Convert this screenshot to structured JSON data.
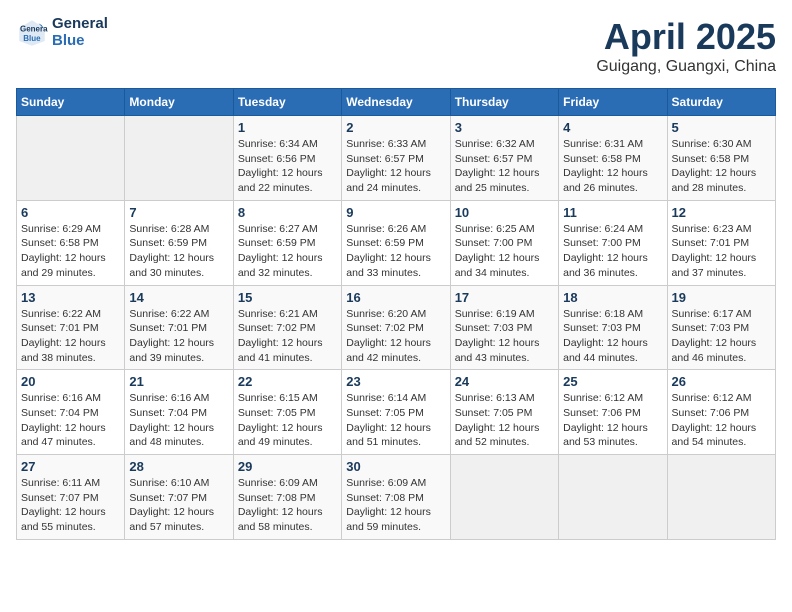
{
  "header": {
    "logo_line1": "General",
    "logo_line2": "Blue",
    "month_title": "April 2025",
    "location": "Guigang, Guangxi, China"
  },
  "weekdays": [
    "Sunday",
    "Monday",
    "Tuesday",
    "Wednesday",
    "Thursday",
    "Friday",
    "Saturday"
  ],
  "weeks": [
    [
      {
        "day": "",
        "info": ""
      },
      {
        "day": "",
        "info": ""
      },
      {
        "day": "1",
        "info": "Sunrise: 6:34 AM\nSunset: 6:56 PM\nDaylight: 12 hours\nand 22 minutes."
      },
      {
        "day": "2",
        "info": "Sunrise: 6:33 AM\nSunset: 6:57 PM\nDaylight: 12 hours\nand 24 minutes."
      },
      {
        "day": "3",
        "info": "Sunrise: 6:32 AM\nSunset: 6:57 PM\nDaylight: 12 hours\nand 25 minutes."
      },
      {
        "day": "4",
        "info": "Sunrise: 6:31 AM\nSunset: 6:58 PM\nDaylight: 12 hours\nand 26 minutes."
      },
      {
        "day": "5",
        "info": "Sunrise: 6:30 AM\nSunset: 6:58 PM\nDaylight: 12 hours\nand 28 minutes."
      }
    ],
    [
      {
        "day": "6",
        "info": "Sunrise: 6:29 AM\nSunset: 6:58 PM\nDaylight: 12 hours\nand 29 minutes."
      },
      {
        "day": "7",
        "info": "Sunrise: 6:28 AM\nSunset: 6:59 PM\nDaylight: 12 hours\nand 30 minutes."
      },
      {
        "day": "8",
        "info": "Sunrise: 6:27 AM\nSunset: 6:59 PM\nDaylight: 12 hours\nand 32 minutes."
      },
      {
        "day": "9",
        "info": "Sunrise: 6:26 AM\nSunset: 6:59 PM\nDaylight: 12 hours\nand 33 minutes."
      },
      {
        "day": "10",
        "info": "Sunrise: 6:25 AM\nSunset: 7:00 PM\nDaylight: 12 hours\nand 34 minutes."
      },
      {
        "day": "11",
        "info": "Sunrise: 6:24 AM\nSunset: 7:00 PM\nDaylight: 12 hours\nand 36 minutes."
      },
      {
        "day": "12",
        "info": "Sunrise: 6:23 AM\nSunset: 7:01 PM\nDaylight: 12 hours\nand 37 minutes."
      }
    ],
    [
      {
        "day": "13",
        "info": "Sunrise: 6:22 AM\nSunset: 7:01 PM\nDaylight: 12 hours\nand 38 minutes."
      },
      {
        "day": "14",
        "info": "Sunrise: 6:22 AM\nSunset: 7:01 PM\nDaylight: 12 hours\nand 39 minutes."
      },
      {
        "day": "15",
        "info": "Sunrise: 6:21 AM\nSunset: 7:02 PM\nDaylight: 12 hours\nand 41 minutes."
      },
      {
        "day": "16",
        "info": "Sunrise: 6:20 AM\nSunset: 7:02 PM\nDaylight: 12 hours\nand 42 minutes."
      },
      {
        "day": "17",
        "info": "Sunrise: 6:19 AM\nSunset: 7:03 PM\nDaylight: 12 hours\nand 43 minutes."
      },
      {
        "day": "18",
        "info": "Sunrise: 6:18 AM\nSunset: 7:03 PM\nDaylight: 12 hours\nand 44 minutes."
      },
      {
        "day": "19",
        "info": "Sunrise: 6:17 AM\nSunset: 7:03 PM\nDaylight: 12 hours\nand 46 minutes."
      }
    ],
    [
      {
        "day": "20",
        "info": "Sunrise: 6:16 AM\nSunset: 7:04 PM\nDaylight: 12 hours\nand 47 minutes."
      },
      {
        "day": "21",
        "info": "Sunrise: 6:16 AM\nSunset: 7:04 PM\nDaylight: 12 hours\nand 48 minutes."
      },
      {
        "day": "22",
        "info": "Sunrise: 6:15 AM\nSunset: 7:05 PM\nDaylight: 12 hours\nand 49 minutes."
      },
      {
        "day": "23",
        "info": "Sunrise: 6:14 AM\nSunset: 7:05 PM\nDaylight: 12 hours\nand 51 minutes."
      },
      {
        "day": "24",
        "info": "Sunrise: 6:13 AM\nSunset: 7:05 PM\nDaylight: 12 hours\nand 52 minutes."
      },
      {
        "day": "25",
        "info": "Sunrise: 6:12 AM\nSunset: 7:06 PM\nDaylight: 12 hours\nand 53 minutes."
      },
      {
        "day": "26",
        "info": "Sunrise: 6:12 AM\nSunset: 7:06 PM\nDaylight: 12 hours\nand 54 minutes."
      }
    ],
    [
      {
        "day": "27",
        "info": "Sunrise: 6:11 AM\nSunset: 7:07 PM\nDaylight: 12 hours\nand 55 minutes."
      },
      {
        "day": "28",
        "info": "Sunrise: 6:10 AM\nSunset: 7:07 PM\nDaylight: 12 hours\nand 57 minutes."
      },
      {
        "day": "29",
        "info": "Sunrise: 6:09 AM\nSunset: 7:08 PM\nDaylight: 12 hours\nand 58 minutes."
      },
      {
        "day": "30",
        "info": "Sunrise: 6:09 AM\nSunset: 7:08 PM\nDaylight: 12 hours\nand 59 minutes."
      },
      {
        "day": "",
        "info": ""
      },
      {
        "day": "",
        "info": ""
      },
      {
        "day": "",
        "info": ""
      }
    ]
  ]
}
